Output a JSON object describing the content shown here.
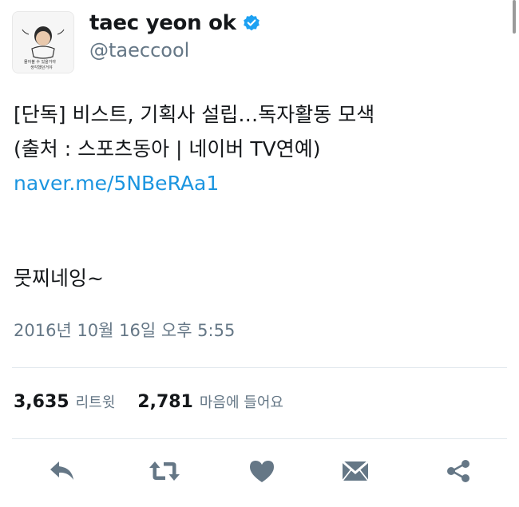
{
  "profile": {
    "display_name": "taec yeon ok",
    "handle": "@taeccool",
    "avatar_caption": "나가 쓰기 / 물어봐 수 있을거야 생각했던거야"
  },
  "tweet": {
    "lines": [
      "[단독] 비스트, 기획사 설립…독자활동 모색",
      "(출처 : 스포츠동아 | 네이버 TV연예)"
    ],
    "link": "naver.me/5NBeRAa1",
    "comment": "뭇찌네잉~",
    "timestamp": "2016년 10월 16일 오후 5:55"
  },
  "stats": {
    "retweets_count": "3,635",
    "retweets_label": "리트윗",
    "likes_count": "2,781",
    "likes_label": "마음에 들어요"
  },
  "actions": [
    "reply-icon",
    "retweet-icon",
    "like-icon",
    "message-icon",
    "share-icon"
  ],
  "colors": {
    "link": "#1b95e0",
    "secondary_text": "#657786",
    "icon": "#657786",
    "divider": "#e1e8ed",
    "verified": "#1da1f2"
  }
}
